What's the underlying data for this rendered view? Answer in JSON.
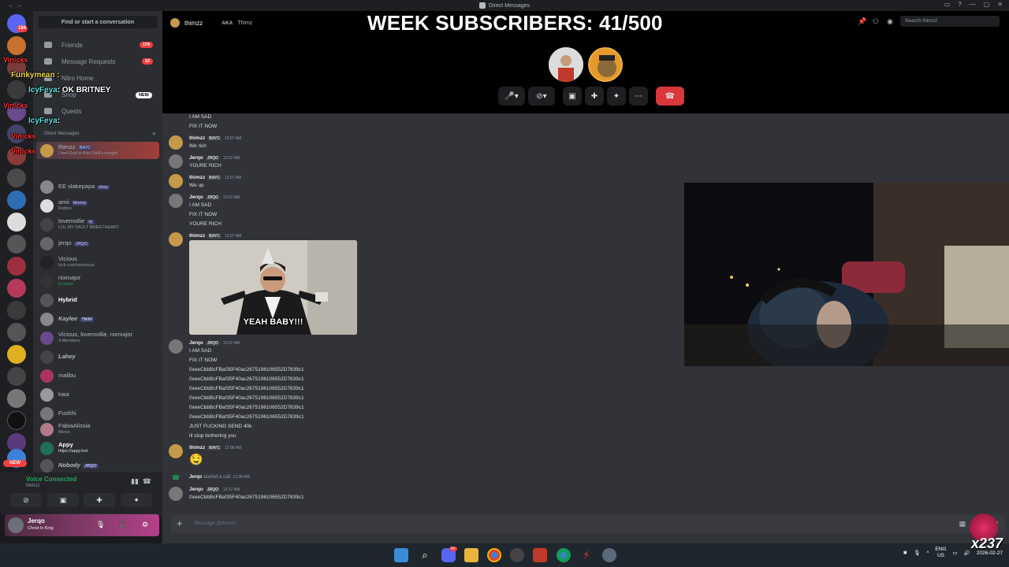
{
  "window": {
    "title": "Direct Messages"
  },
  "sidebar": {
    "search_label": "Find or start a conversation",
    "nav": [
      {
        "label": "Friends",
        "count": "174"
      },
      {
        "label": "Message Requests",
        "count": "10"
      },
      {
        "label": "Nitro Home"
      },
      {
        "label": "Shop"
      },
      {
        "label": "Quests"
      }
    ],
    "dm_header": "Direct Messages",
    "dms": [
      {
        "name": "thimzz",
        "tag": "BAYC",
        "sub": "I feel God in this Chilli's tonight"
      },
      {
        "name": "EE slakepapa",
        "tag": "ebay",
        "sub": ""
      },
      {
        "name": "amii",
        "tag": "Moony",
        "sub": "Roblox"
      },
      {
        "name": "lovemollie",
        "tag": "ily",
        "sub": "LOL MY FAULT $WEETHEART"
      },
      {
        "name": "jerqo",
        "tag": "JRQO",
        "sub": ""
      },
      {
        "name": "Vicious",
        "tag": "",
        "sub": "kick.com/sovicious"
      },
      {
        "name": "nixmajor",
        "tag": "",
        "sub": "In voice"
      },
      {
        "name": "Hybrid",
        "tag": "",
        "sub": ""
      },
      {
        "name": "Kaylee",
        "tag": "TWW",
        "sub": ""
      },
      {
        "name": "Vicious, lovemollie, nixmajor",
        "tag": "",
        "sub": "4 Members"
      },
      {
        "name": "Lahey",
        "tag": "",
        "sub": ""
      },
      {
        "name": "malibu",
        "tag": "",
        "sub": ""
      },
      {
        "name": "kaia",
        "tag": "",
        "sub": ""
      },
      {
        "name": "Fushhi",
        "tag": "",
        "sub": ""
      },
      {
        "name": "FabiaAlissia",
        "tag": "",
        "sub": "Meow"
      },
      {
        "name": "Appy",
        "tag": "",
        "sub": "https://appy.bot"
      },
      {
        "name": "Nobody",
        "tag": "JRQO",
        "sub": ""
      }
    ],
    "overlay_chat": [
      {
        "user": "Vinicks",
        "text": ""
      },
      {
        "user": "Funkymean",
        "text": ":"
      },
      {
        "user": "IcyFeya",
        "text": ": OK BRITNEY"
      },
      {
        "user": "Vinicks",
        "text": ""
      },
      {
        "user": "IcyFeya",
        "text": ":"
      },
      {
        "user": "Vinicks",
        "text": ""
      },
      {
        "user": "Vinicks",
        "text": ""
      }
    ],
    "new_badge": "NEW",
    "voice": {
      "status": "Voice Connected",
      "channel": "thimzz"
    },
    "user": {
      "name": "Jerqo",
      "status": "Christ Is King"
    }
  },
  "rail": {
    "badges": [
      "184"
    ],
    "new_label": "NEW"
  },
  "header": {
    "username": "thimzz",
    "aka_label": "AKA",
    "aka_value": "Thimz",
    "search_placeholder": "Search thimzz"
  },
  "overlay_title": "WEEK SUBSCRIBERS: 41/500",
  "messages": [
    {
      "lines": [
        "I AM SAD",
        "FIX IT NOW"
      ]
    },
    {
      "author": "thimzz",
      "tag": "BAYC",
      "time": "12:07 AM",
      "lines": [
        "We rich"
      ]
    },
    {
      "author": "Jerqo",
      "tag": "JRQO",
      "time": "12:07 AM",
      "lines": [
        "YOURE RICH"
      ]
    },
    {
      "author": "thimzz",
      "tag": "BAYC",
      "time": "12:07 AM",
      "lines": [
        "We up"
      ]
    },
    {
      "author": "Jerqo",
      "tag": "JRQO",
      "time": "12:07 AM",
      "lines": [
        "I AM SAD",
        "FIX IT NOW",
        "YOURE RICH"
      ]
    },
    {
      "author": "thimzz",
      "tag": "BAYC",
      "time": "12:07 AM",
      "gif_caption": "YEAH BABY!!!"
    },
    {
      "author": "Jerqo",
      "tag": "JRQO",
      "time": "12:07 AM",
      "lines": [
        "I AM SAD",
        "FIX IT NOW",
        "0xeeCbbBcFBaf35F40ac2675196106552D7839c1",
        "0xeeCbbBcFBaf35F40ac2675196106552D7839c1",
        "0xeeCbbBcFBaf35F40ac2675196106552D7839c1",
        "0xeeCbbBcFBaf35F40ac2675196106552D7839c1",
        "0xeeCbbBcFBaf35F40ac2675196106552D7839c1",
        "0xeeCbbBcFBaf35F40ac2675196106552D7839c1",
        "JUST FUCKING SEND 40k",
        "ill stop bothering you"
      ]
    },
    {
      "author": "thimzz",
      "tag": "BAYC",
      "time": "12:08 AM",
      "emoji": "🤤"
    },
    {
      "system_user": "Jerqo",
      "system_text": "started a call.",
      "time": "12:08 AM"
    },
    {
      "author": "Jerqo",
      "tag": "JRQO",
      "time": "12:17 AM",
      "lines": [
        "0xeeCbbBcFBaf35F40ac2675196106552D7839c1"
      ]
    }
  ],
  "composer": {
    "placeholder": "Message @thimzz"
  },
  "taskbar": {
    "lang": [
      "ENG",
      "US"
    ],
    "clock": [
      "",
      "2026-02-27"
    ],
    "watermark": "x237",
    "discord_badge": "9+"
  }
}
